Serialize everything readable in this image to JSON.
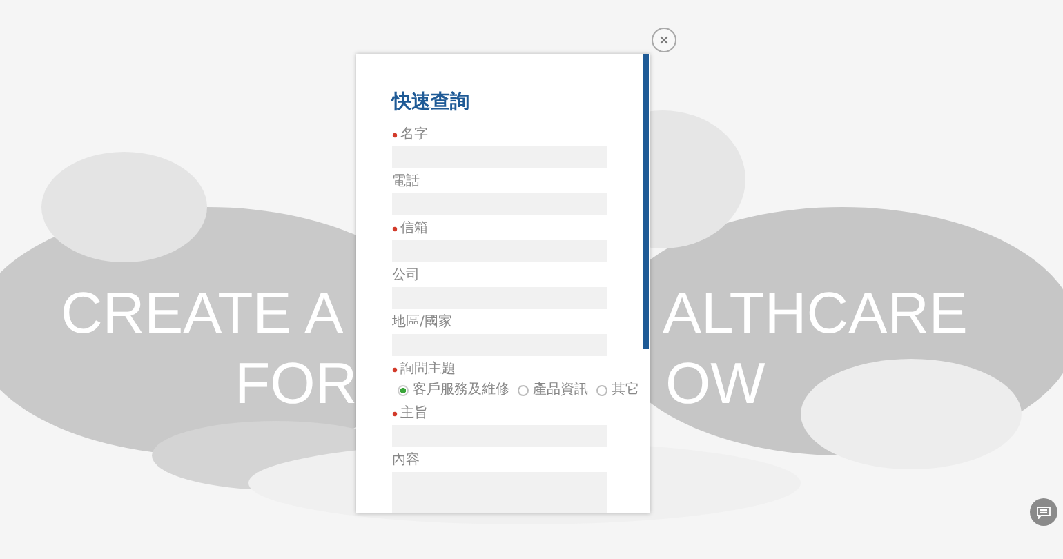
{
  "hero": {
    "line_1_left": "CREATE A",
    "line_1_right": "ALTHCARE",
    "line_2_left": "FOR",
    "line_2_right": "OW"
  },
  "dialog": {
    "title": "快速查詢",
    "fields": [
      {
        "kind": "text",
        "label": "名字",
        "required": true
      },
      {
        "kind": "text",
        "label": "電話",
        "required": false
      },
      {
        "kind": "text",
        "label": "信箱",
        "required": true
      },
      {
        "kind": "text",
        "label": "公司",
        "required": false
      },
      {
        "kind": "text",
        "label": "地區/國家",
        "required": false
      },
      {
        "kind": "radio",
        "label": "詢問主題",
        "required": true,
        "options": [
          {
            "label": "客戶服務及維修",
            "selected": true
          },
          {
            "label": "產品資訊",
            "selected": false
          },
          {
            "label": "其它",
            "selected": false
          }
        ]
      },
      {
        "kind": "text",
        "label": "主旨",
        "required": true
      },
      {
        "kind": "textarea",
        "label": "內容",
        "required": false
      }
    ]
  }
}
